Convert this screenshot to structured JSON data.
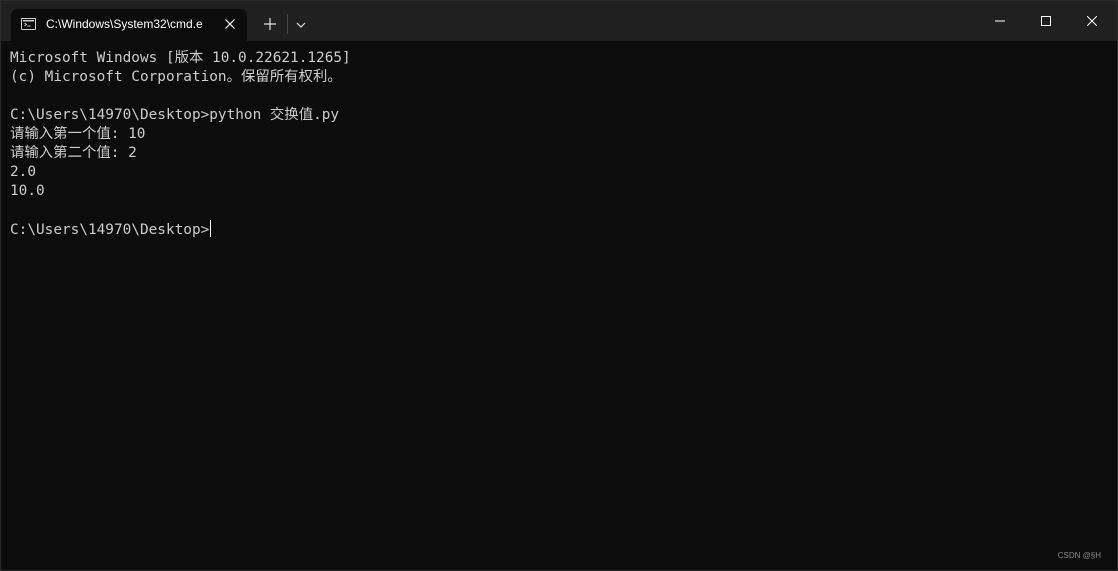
{
  "tab": {
    "title": "C:\\Windows\\System32\\cmd.e"
  },
  "terminal": {
    "lines": [
      "Microsoft Windows [版本 10.0.22621.1265]",
      "(c) Microsoft Corporation。保留所有权利。",
      "",
      "C:\\Users\\14970\\Desktop>python 交换值.py",
      "请输入第一个值: 10",
      "请输入第二个值: 2",
      "2.0",
      "10.0",
      "",
      "C:\\Users\\14970\\Desktop>"
    ]
  },
  "watermark": "CSDN @§H",
  "colors": {
    "background": "#0c0c0c",
    "titlebar": "#202020",
    "text": "#cccccc"
  },
  "icons": {
    "tab": "terminal-icon",
    "close": "close-icon",
    "new_tab": "plus-icon",
    "dropdown": "chevron-down-icon",
    "minimize": "minimize-icon",
    "maximize": "maximize-icon",
    "window_close": "close-icon"
  }
}
